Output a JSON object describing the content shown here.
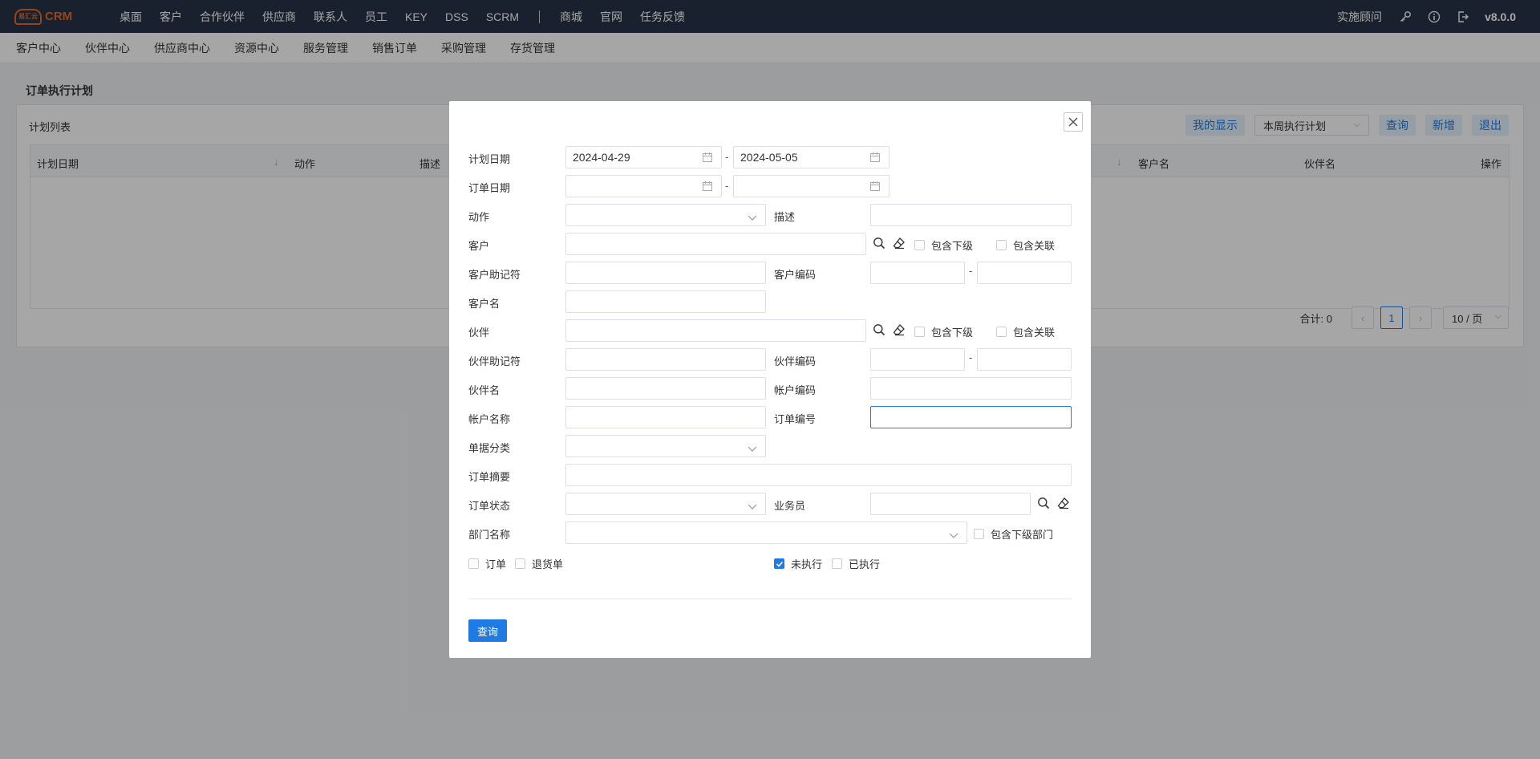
{
  "app": {
    "logo_mark": "易汇云",
    "logo_text": "CRM",
    "version": "v8.0.0",
    "advisor": "实施顾问"
  },
  "topnav": [
    "桌面",
    "客户",
    "合作伙伴",
    "供应商",
    "联系人",
    "员工",
    "KEY",
    "DSS",
    "SCRM"
  ],
  "topnav_extra": [
    "商城",
    "官网",
    "任务反馈"
  ],
  "subnav": [
    "客户中心",
    "伙伴中心",
    "供应商中心",
    "资源中心",
    "服务管理",
    "销售订单",
    "采购管理",
    "存货管理"
  ],
  "page": {
    "title": "订单执行计划",
    "panel_title": "计划列表",
    "toolbar": {
      "my_display": "我的显示",
      "plan_select": "本周执行计划",
      "query": "查询",
      "add": "新增",
      "exit": "退出"
    },
    "columns": [
      "计划日期",
      "动作",
      "描述",
      "客户名",
      "伙伴名",
      "操作"
    ],
    "pager": {
      "total_label": "合计:",
      "total": "0",
      "current": "1",
      "page_size": "10 / 页"
    }
  },
  "dialog": {
    "labels": {
      "plan_date": "计划日期",
      "order_date": "订单日期",
      "action": "动作",
      "desc": "描述",
      "customer": "客户",
      "cust_mnemonic": "客户助记符",
      "cust_code": "客户编码",
      "cust_name": "客户名",
      "partner": "伙伴",
      "partner_mnemonic": "伙伴助记符",
      "partner_code": "伙伴编码",
      "partner_name": "伙伴名",
      "account_code": "帐户编码",
      "account_name": "帐户名称",
      "order_no": "订单编号",
      "doc_type": "单据分类",
      "order_summary": "订单摘要",
      "order_status": "订单状态",
      "salesman": "业务员",
      "dept_name": "部门名称"
    },
    "values": {
      "plan_date_from": "2024-04-29",
      "plan_date_to": "2024-05-05"
    },
    "checks": {
      "include_sub": "包含下级",
      "include_rel": "包含关联",
      "include_sub_dept": "包含下级部门",
      "order": "订单",
      "return_order": "退货单",
      "not_executed": "未执行",
      "executed": "已执行"
    },
    "check_states": {
      "not_executed": true
    },
    "query_button": "查询"
  }
}
